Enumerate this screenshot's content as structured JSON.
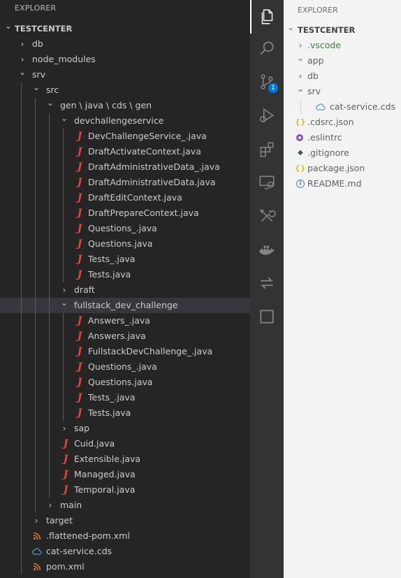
{
  "left_explorer": {
    "header": "EXPLORER",
    "rows": [
      {
        "label": "TESTCENTER",
        "depth": 0,
        "type": "root",
        "expanded": true
      },
      {
        "label": "db",
        "depth": 1,
        "type": "folder",
        "expanded": false
      },
      {
        "label": "node_modules",
        "depth": 1,
        "type": "folder",
        "expanded": false
      },
      {
        "label": "srv",
        "depth": 1,
        "type": "folder",
        "expanded": true
      },
      {
        "label": "src",
        "depth": 2,
        "type": "folder",
        "expanded": true
      },
      {
        "label": "gen \\ java \\ cds \\ gen",
        "depth": 3,
        "type": "folder",
        "expanded": true
      },
      {
        "label": "devchallengeservice",
        "depth": 4,
        "type": "folder",
        "expanded": true
      },
      {
        "label": "DevChallengeService_.java",
        "depth": 5,
        "type": "java"
      },
      {
        "label": "DraftActivateContext.java",
        "depth": 5,
        "type": "java"
      },
      {
        "label": "DraftAdministrativeData_.java",
        "depth": 5,
        "type": "java"
      },
      {
        "label": "DraftAdministrativeData.java",
        "depth": 5,
        "type": "java"
      },
      {
        "label": "DraftEditContext.java",
        "depth": 5,
        "type": "java"
      },
      {
        "label": "DraftPrepareContext.java",
        "depth": 5,
        "type": "java"
      },
      {
        "label": "Questions_.java",
        "depth": 5,
        "type": "java"
      },
      {
        "label": "Questions.java",
        "depth": 5,
        "type": "java"
      },
      {
        "label": "Tests_.java",
        "depth": 5,
        "type": "java"
      },
      {
        "label": "Tests.java",
        "depth": 5,
        "type": "java"
      },
      {
        "label": "draft",
        "depth": 4,
        "type": "folder",
        "expanded": false
      },
      {
        "label": "fullstack_dev_challenge",
        "depth": 4,
        "type": "folder",
        "expanded": true,
        "selected": true
      },
      {
        "label": "Answers_.java",
        "depth": 5,
        "type": "java"
      },
      {
        "label": "Answers.java",
        "depth": 5,
        "type": "java"
      },
      {
        "label": "FullstackDevChallenge_.java",
        "depth": 5,
        "type": "java"
      },
      {
        "label": "Questions_.java",
        "depth": 5,
        "type": "java"
      },
      {
        "label": "Questions.java",
        "depth": 5,
        "type": "java"
      },
      {
        "label": "Tests_.java",
        "depth": 5,
        "type": "java"
      },
      {
        "label": "Tests.java",
        "depth": 5,
        "type": "java"
      },
      {
        "label": "sap",
        "depth": 4,
        "type": "folder",
        "expanded": false
      },
      {
        "label": "Cuid.java",
        "depth": 4,
        "type": "java"
      },
      {
        "label": "Extensible.java",
        "depth": 4,
        "type": "java"
      },
      {
        "label": "Managed.java",
        "depth": 4,
        "type": "java"
      },
      {
        "label": "Temporal.java",
        "depth": 4,
        "type": "java"
      },
      {
        "label": "main",
        "depth": 3,
        "type": "folder",
        "expanded": false
      },
      {
        "label": "target",
        "depth": 2,
        "type": "folder",
        "expanded": false
      },
      {
        "label": ".flattened-pom.xml",
        "depth": 2,
        "type": "xml"
      },
      {
        "label": "cat-service.cds",
        "depth": 2,
        "type": "cds"
      },
      {
        "label": "pom.xml",
        "depth": 2,
        "type": "xml"
      }
    ]
  },
  "activity_bar": {
    "items": [
      {
        "name": "explorer-icon",
        "active": true
      },
      {
        "name": "search-icon"
      },
      {
        "name": "source-control-icon",
        "badge": "1"
      },
      {
        "name": "run-debug-icon"
      },
      {
        "name": "extensions-icon"
      },
      {
        "name": "remote-explorer-icon"
      },
      {
        "name": "tools-icon"
      },
      {
        "name": "docker-icon"
      },
      {
        "name": "transfer-icon"
      },
      {
        "name": "square-icon"
      }
    ]
  },
  "right_explorer": {
    "header": "EXPLORER",
    "rows": [
      {
        "label": "TESTCENTER",
        "depth": 0,
        "type": "root",
        "expanded": true
      },
      {
        "label": ".vscode",
        "depth": 1,
        "type": "folder",
        "expanded": false,
        "color": "green"
      },
      {
        "label": "app",
        "depth": 1,
        "type": "folder",
        "expanded": true
      },
      {
        "label": "db",
        "depth": 1,
        "type": "folder",
        "expanded": false
      },
      {
        "label": "srv",
        "depth": 1,
        "type": "folder",
        "expanded": true
      },
      {
        "label": "cat-service.cds",
        "depth": 2,
        "type": "cds"
      },
      {
        "label": ".cdsrc.json",
        "depth": 1,
        "type": "json"
      },
      {
        "label": ".eslintrc",
        "depth": 1,
        "type": "eslint"
      },
      {
        "label": ".gitignore",
        "depth": 1,
        "type": "git"
      },
      {
        "label": "package.json",
        "depth": 1,
        "type": "json"
      },
      {
        "label": "README.md",
        "depth": 1,
        "type": "info"
      }
    ]
  },
  "colors": {
    "dark_bg": "#252526",
    "activity_bg": "#333333",
    "light_bg": "#f3f3f3",
    "java_red": "#e8453c",
    "badge_blue": "#0078d4"
  }
}
